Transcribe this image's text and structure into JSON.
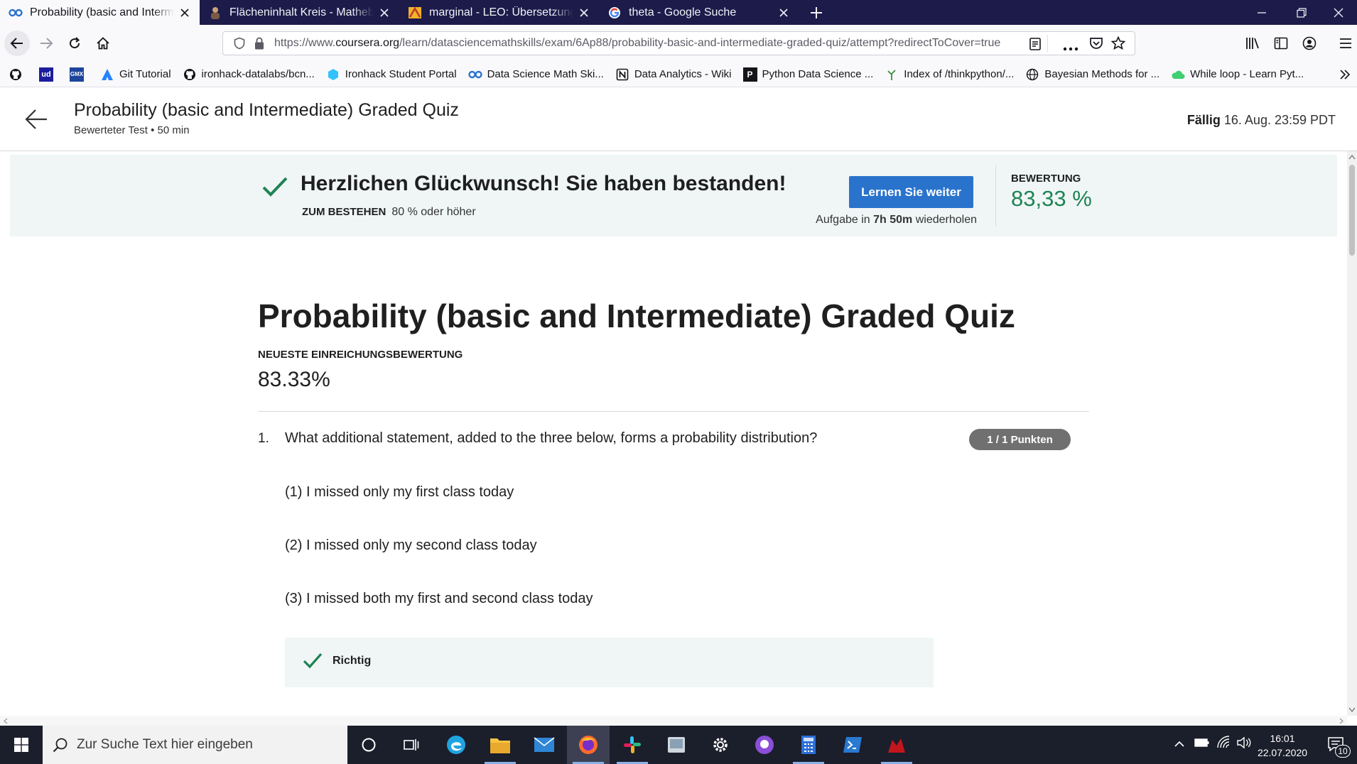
{
  "browser": {
    "tabs": [
      {
        "title": "Probability (basic and Intermed",
        "icon": "coursera-icon",
        "active": true
      },
      {
        "title": "Flächeninhalt Kreis - Mathebibel",
        "icon": "mathebibel-icon",
        "active": false
      },
      {
        "title": "marginal - LEO: Übersetzung im",
        "icon": "leo-icon",
        "active": false
      },
      {
        "title": "theta - Google Suche",
        "icon": "google-icon",
        "active": false
      }
    ],
    "url_prefix": "https://www.",
    "url_domain": "coursera.org",
    "url_path": "/learn/datasciencemathskills/exam/6Ap88/probability-basic-and-intermediate-graded-quiz/attempt?redirectToCover=true",
    "bookmarks": [
      {
        "label": "",
        "icon": "github-icon"
      },
      {
        "label": "",
        "icon": "udemy-icon"
      },
      {
        "label": "",
        "icon": "gmx-icon"
      },
      {
        "label": "Git Tutorial",
        "icon": "atlassian-icon"
      },
      {
        "label": "ironhack-datalabs/bcn...",
        "icon": "github-icon"
      },
      {
        "label": "Ironhack Student Portal",
        "icon": "ironhack-icon"
      },
      {
        "label": "Data Science Math Ski...",
        "icon": "coursera-icon"
      },
      {
        "label": "Data Analytics - Wiki",
        "icon": "notion-icon"
      },
      {
        "label": "Python Data Science ...",
        "icon": "p-icon"
      },
      {
        "label": "Index of /thinkpython/...",
        "icon": "tree-icon"
      },
      {
        "label": "Bayesian Methods for ...",
        "icon": "globe-icon"
      },
      {
        "label": "While loop - Learn Pyt...",
        "icon": "cloud-icon"
      }
    ]
  },
  "header": {
    "title": "Probability (basic and Intermediate) Graded Quiz",
    "subtitle": "Bewerteter Test • 50 min",
    "due_label": "Fällig",
    "due_value": "16. Aug. 23:59 PDT"
  },
  "banner": {
    "headline": "Herzlichen Glückwunsch! Sie haben bestanden!",
    "pass_label": "ZUM BESTEHEN",
    "pass_value": "80 % oder höher",
    "continue_button": "Lernen Sie weiter",
    "retry_prefix": "Aufgabe in",
    "retry_time": "7h 50m",
    "retry_suffix": "wiederholen",
    "grade_label": "BEWERTUNG",
    "grade_value": "83,33 %"
  },
  "main": {
    "title": "Probability (basic and Intermediate) Graded Quiz",
    "latest_label": "NEUESTE EINREICHUNGSBEWERTUNG",
    "latest_value": "83.33%",
    "question": {
      "number": "1.",
      "text": "What additional statement, added to the three below, forms a probability distribution?",
      "points": "1 / 1 Punkten",
      "statements": [
        "(1) I missed only my first class today",
        "(2) I missed only my second class today",
        "(3) I missed both my first and second class today"
      ],
      "result": "Richtig"
    }
  },
  "taskbar": {
    "search_placeholder": "Zur Suche Text hier eingeben",
    "time": "16:01",
    "date": "22.07.2020",
    "notification_count": "10"
  },
  "colors": {
    "tabbar": "#1c1b4a",
    "accent_green": "#1f8354",
    "button_blue": "#2a73cc",
    "banner_bg": "#f0f6f6"
  }
}
